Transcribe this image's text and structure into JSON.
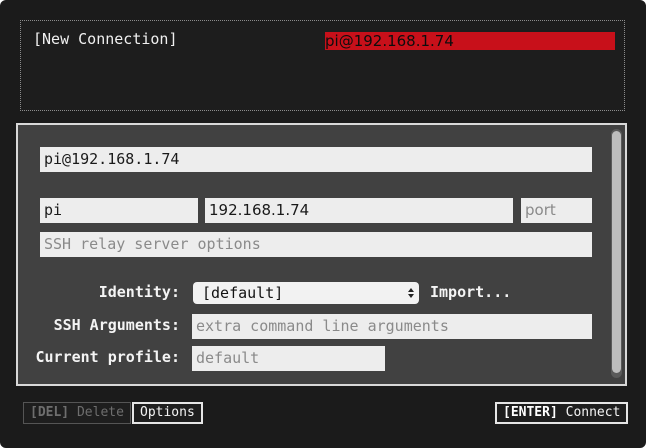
{
  "connections": {
    "new_connection_label": "[New Connection]",
    "selected_label": "pi@192.168.1.74"
  },
  "editor": {
    "title_value": "pi@192.168.1.74",
    "user_value": "pi",
    "host_value": "192.168.1.74",
    "port_placeholder": "port",
    "relay_placeholder": "SSH relay server options",
    "identity_label": "Identity:",
    "identity_value": "[default]",
    "import_label": "Import...",
    "ssh_args_label": "SSH Arguments:",
    "ssh_args_placeholder": "extra command line arguments",
    "profile_label": "Current profile:",
    "profile_placeholder": "default"
  },
  "buttons": {
    "delete_key": "[DEL]",
    "delete_label": "Delete",
    "options_label": "Options",
    "connect_key": "[ENTER]",
    "connect_label": "Connect"
  },
  "colors": {
    "selection": "#c8101a",
    "window_bg": "#1b1b1b",
    "panel_bg": "#414141",
    "field_bg": "#ededed"
  }
}
